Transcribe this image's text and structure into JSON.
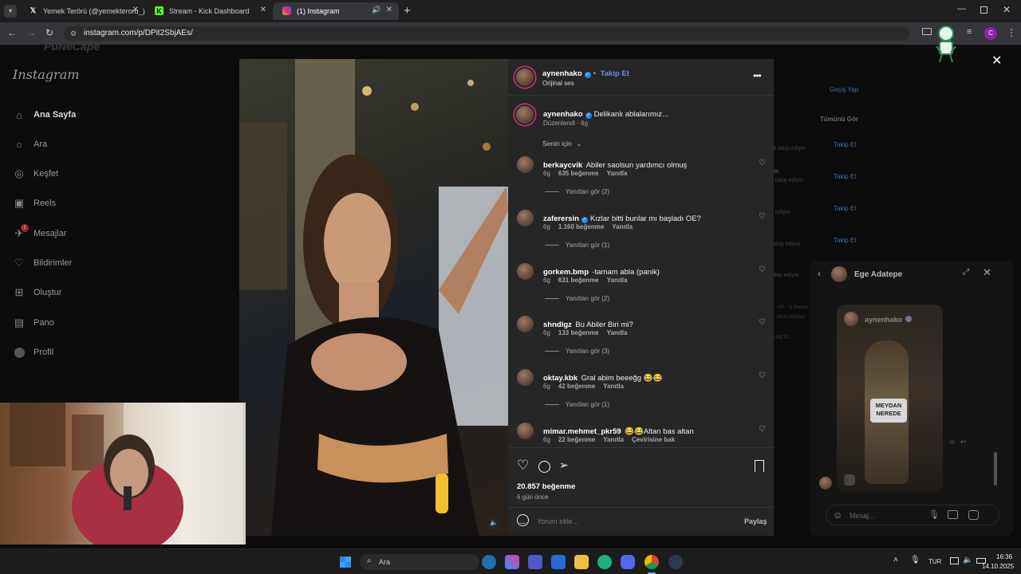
{
  "browser": {
    "tabs": [
      {
        "title": "Yemek Terörü (@yemekteroru_)",
        "icon": "x-logo-icon"
      },
      {
        "title": "Stream - Kick Dashboard",
        "icon": "kick-logo-icon"
      },
      {
        "title": "(1) Instagram",
        "icon": "instagram-logo-icon"
      }
    ],
    "new_tab": "+",
    "url": "instagram.com/p/DPit2SbjAEs/",
    "profile_initial": "C"
  },
  "watermark": "PuNeCape",
  "instagram": {
    "logo": "Instagram",
    "nav": [
      {
        "label": "Ana Sayfa",
        "icon": "home-icon",
        "active": true
      },
      {
        "label": "Ara",
        "icon": "search-icon"
      },
      {
        "label": "Keşfet",
        "icon": "compass-icon"
      },
      {
        "label": "Reels",
        "icon": "reels-icon"
      },
      {
        "label": "Mesajlar",
        "icon": "messenger-icon",
        "badge": "1"
      },
      {
        "label": "Bildirimler",
        "icon": "heart-icon"
      },
      {
        "label": "Oluştur",
        "icon": "plus-square-icon"
      },
      {
        "label": "Pano",
        "icon": "chart-icon"
      },
      {
        "label": "Profil",
        "icon": "profile-avatar-icon"
      }
    ]
  },
  "post": {
    "author": "aynenhako",
    "follow": "Takip Et",
    "dot": "•",
    "audio": "Orijinal ses",
    "caption_user": "aynenhako",
    "caption_text": "Delikanlı ablalarımız...",
    "caption_meta": "Düzenlendi · 6g",
    "sort": "Senin için",
    "likes": "20.857 beğenme",
    "time": "6 gün önce",
    "comment_placeholder": "Yorum ekle...",
    "share": "Paylaş",
    "comments": [
      {
        "user": "berkaycvik",
        "text": "Abiler saolsun yardımcı olmuş",
        "age": "6g",
        "likes": "635 beğenme",
        "reply": "Yanıtla",
        "replies": "Yanıtları gör (2)"
      },
      {
        "user": "zaferersin",
        "verified": true,
        "text": "Kızlar bitti bunlar mı başladı OE?",
        "age": "6g",
        "likes": "1.160 beğenme",
        "reply": "Yanıtla",
        "replies": "Yanıtları gör (1)"
      },
      {
        "user": "gorkem.bmp",
        "text": "-tamam abla (panik)",
        "age": "6g",
        "likes": "631 beğenme",
        "reply": "Yanıtla",
        "replies": "Yanıtları gör (2)"
      },
      {
        "user": "shndlgz",
        "text": "Bu Abiler Biri mi?",
        "age": "6g",
        "likes": "133 beğenme",
        "reply": "Yanıtla",
        "replies": "Yanıtları gör (3)"
      },
      {
        "user": "oktay.kbk",
        "text": "Gral abim beeeğg 😂😂",
        "age": "6g",
        "likes": "42 beğenme",
        "reply": "Yanıtla",
        "replies": "Yanıtları gör (1)"
      },
      {
        "user": "mimar.mehmet_pkr59",
        "text": "😂😂Altan bas altan",
        "age": "6g",
        "likes": "22 beğenme",
        "reply": "Yanıtla",
        "translate": "Çevirisine bak"
      }
    ]
  },
  "background_right": {
    "switch": "Geçiş Yap",
    "see_all": "Tümünü Gör",
    "follow_links": [
      "Takip Et",
      "Takip Et",
      "Takip Et",
      "Takip Et"
    ],
    "fragments": [
      "ck takip ediyor",
      "in",
      "n takip ediyor",
      "ediyor",
      "takip ediyor",
      "takip ediyor",
      "API · İş İlanları",
      "Meta Verified",
      "M META"
    ]
  },
  "chat": {
    "name": "Ege Adatepe",
    "shared_user": "aynenhako",
    "sticker": "MEYDAN NEREDE",
    "placeholder": "Mesaj..."
  },
  "taskbar": {
    "search": "Ara",
    "lang": "TUR",
    "time": "16:36",
    "date": "14.10.2025"
  }
}
